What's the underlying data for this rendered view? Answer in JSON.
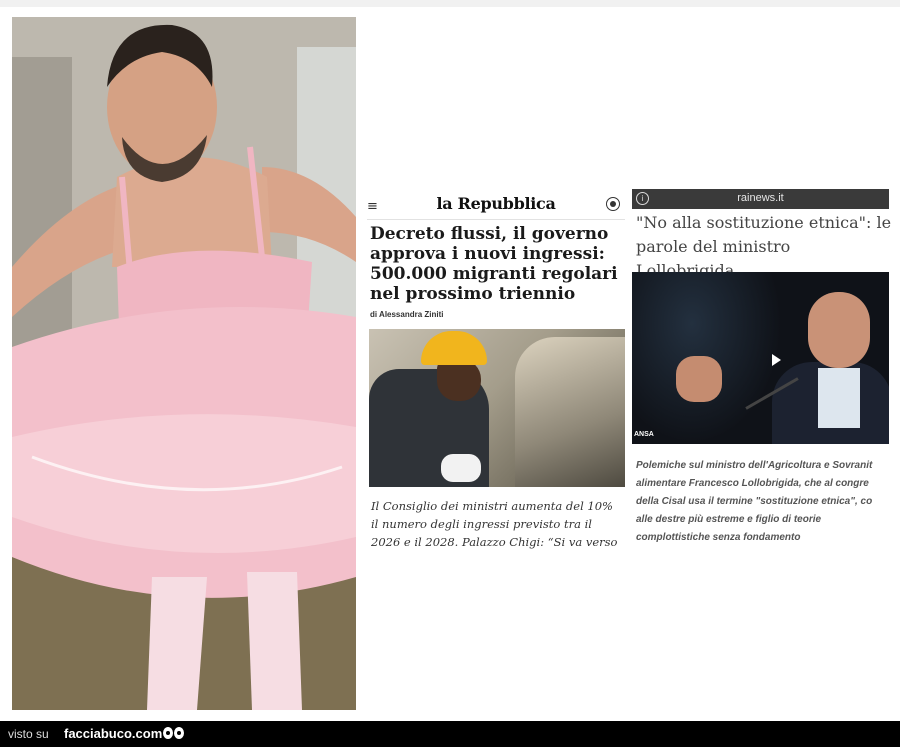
{
  "repubblica": {
    "menu_icon": "≡",
    "logo": "la Repubblica",
    "headline_lines": [
      "Decreto flussi, il governo",
      "approva i nuovi ingressi:",
      "500.000 migranti regolari",
      "nel prossimo triennio"
    ],
    "author": "di Alessandra Ziniti",
    "caption_lines": [
      "Il Consiglio dei ministri aumenta del 10%",
      "il numero degli ingressi previsto tra il",
      "2026 e il 2028. Palazzo Chigi: “Si va verso"
    ]
  },
  "rainews": {
    "info_icon": "i",
    "site": "rainews.it",
    "headline_lines": [
      "\"No alla sostituzione etnica\": le",
      "parole del ministro Lollobrigida"
    ],
    "photo_credit": "ANSA",
    "summary_lines": [
      "Polemiche sul ministro dell'Agricoltura e Sovranit",
      "alimentare Francesco Lollobrigida, che al congre",
      "della Cisal usa il termine \"sostituzione etnica\", co",
      "alle destre più estreme e figlio di teorie",
      "complottistiche senza fondamento"
    ]
  },
  "footer": {
    "prefix": "visto su",
    "brand": "facciabuco.com"
  }
}
